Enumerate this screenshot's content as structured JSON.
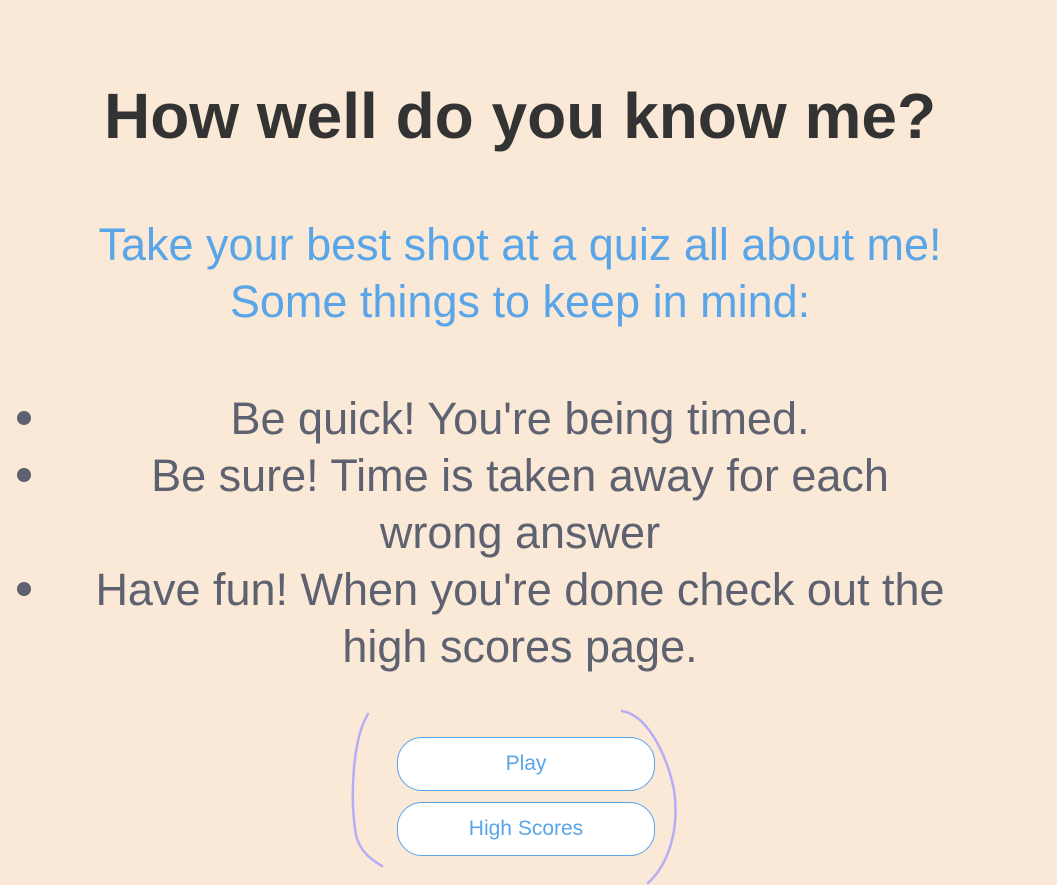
{
  "header": {
    "title": "How well do you know me?"
  },
  "intro": {
    "line1": "Take your best shot at a quiz all about me!",
    "line2": "Some things to keep in mind:"
  },
  "rules": [
    {
      "line1": "Be quick! You're being timed.",
      "line2": ""
    },
    {
      "line1": "Be sure! Time is taken away for each",
      "line2": "wrong answer"
    },
    {
      "line1": "Have fun! When you're done check out the",
      "line2": "high scores page."
    }
  ],
  "buttons": {
    "play_label": "Play",
    "high_scores_label": "High Scores"
  },
  "colors": {
    "background": "#fae9d6",
    "title": "#333333",
    "accent": "#5aa5e8",
    "body_text": "#5e6170",
    "bracket": "#b7adf5"
  }
}
